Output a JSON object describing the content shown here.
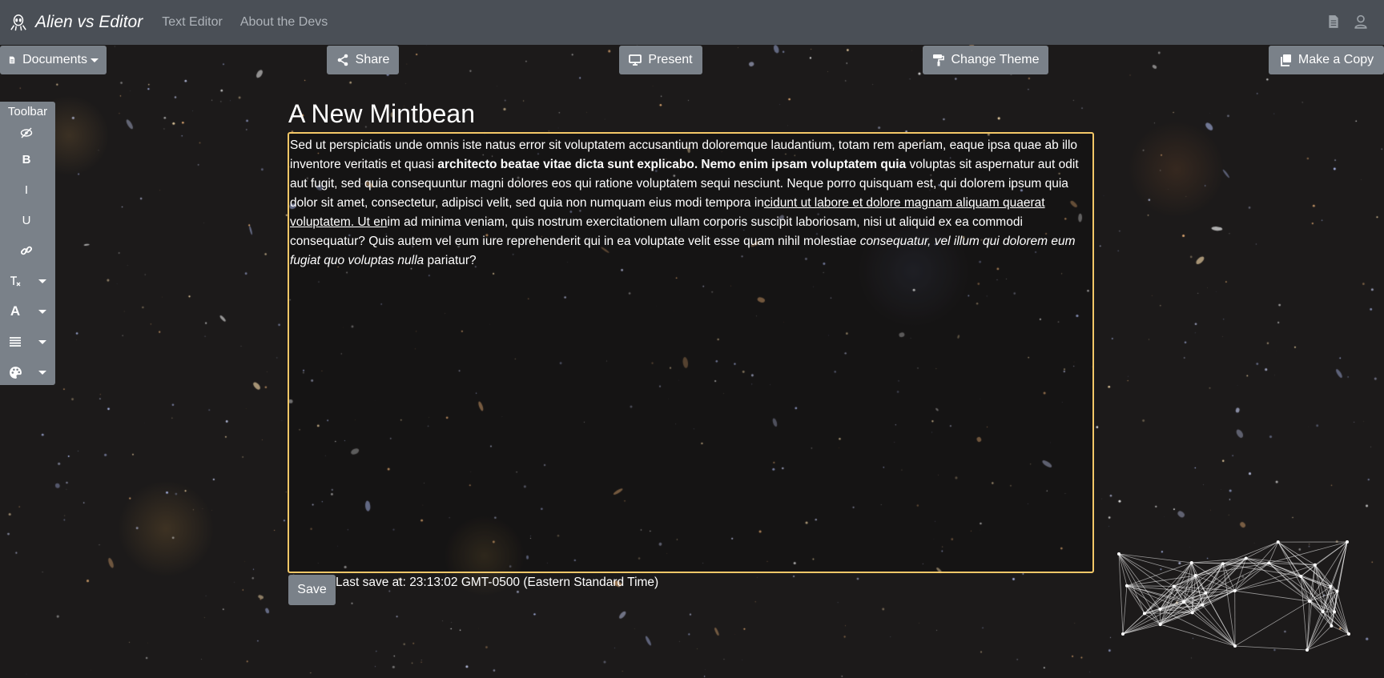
{
  "nav": {
    "brand": "Alien vs Editor",
    "links": [
      "Text Editor",
      "About the Devs"
    ]
  },
  "actions": {
    "documents": "Documents",
    "share": "Share",
    "present": "Present",
    "change_theme": "Change Theme",
    "make_copy": "Make a Copy"
  },
  "toolbar": {
    "title": "Toolbar",
    "tools": [
      "visibility-off-icon",
      "bold",
      "italic",
      "underline",
      "link-icon",
      "clear-format-icon",
      "font-color-icon",
      "align-icon",
      "palette-icon"
    ],
    "bold_label": "B",
    "italic_label": "I",
    "underline_label": "U",
    "font_label": "A"
  },
  "document": {
    "title": "A New Mintbean",
    "segments": [
      {
        "text": "Sed ut perspiciatis unde omnis iste natus error sit voluptatem accusantium doloremque laudantium, totam rem aperiam, eaque ipsa quae ab illo inventore veritatis et quasi ",
        "style": "normal"
      },
      {
        "text": "architecto beatae vitae dicta sunt explicabo. Nemo enim ipsam voluptatem quia",
        "style": "bold"
      },
      {
        "text": " voluptas sit aspernatur aut odit aut fugit, sed quia consequuntur magni dolores eos qui ratione voluptatem sequi nesciunt. Neque porro quisquam est, qui dolorem ipsum quia dolor sit amet, consectetur, adipisci velit, sed quia non numquam eius modi tempora in",
        "style": "normal"
      },
      {
        "text": "cidunt ut labore et dolore magnam aliquam quaerat voluptatem. Ut en",
        "style": "underline"
      },
      {
        "text": "im ad minima veniam, quis nostrum exercitationem ullam corporis suscipit laboriosam, nisi ut aliquid ex ea commodi consequatur? Quis autem vel eum iure reprehenderit qui in ea voluptate velit esse quam nihil molestiae ",
        "style": "normal"
      },
      {
        "text": "consequatur, vel illum qui dolorem eum fugiat quo voluptas nulla",
        "style": "italic"
      },
      {
        "text": " pariatur?",
        "style": "normal"
      }
    ]
  },
  "footer": {
    "save_label": "Save",
    "last_save": "Last save at: 23:13:02 GMT-0500 (Eastern Standard Time)"
  },
  "colors": {
    "navbar": "#4a4f56",
    "button": "#7a8189",
    "editor_border": "#f3c767",
    "background": "#1c1a1a"
  }
}
